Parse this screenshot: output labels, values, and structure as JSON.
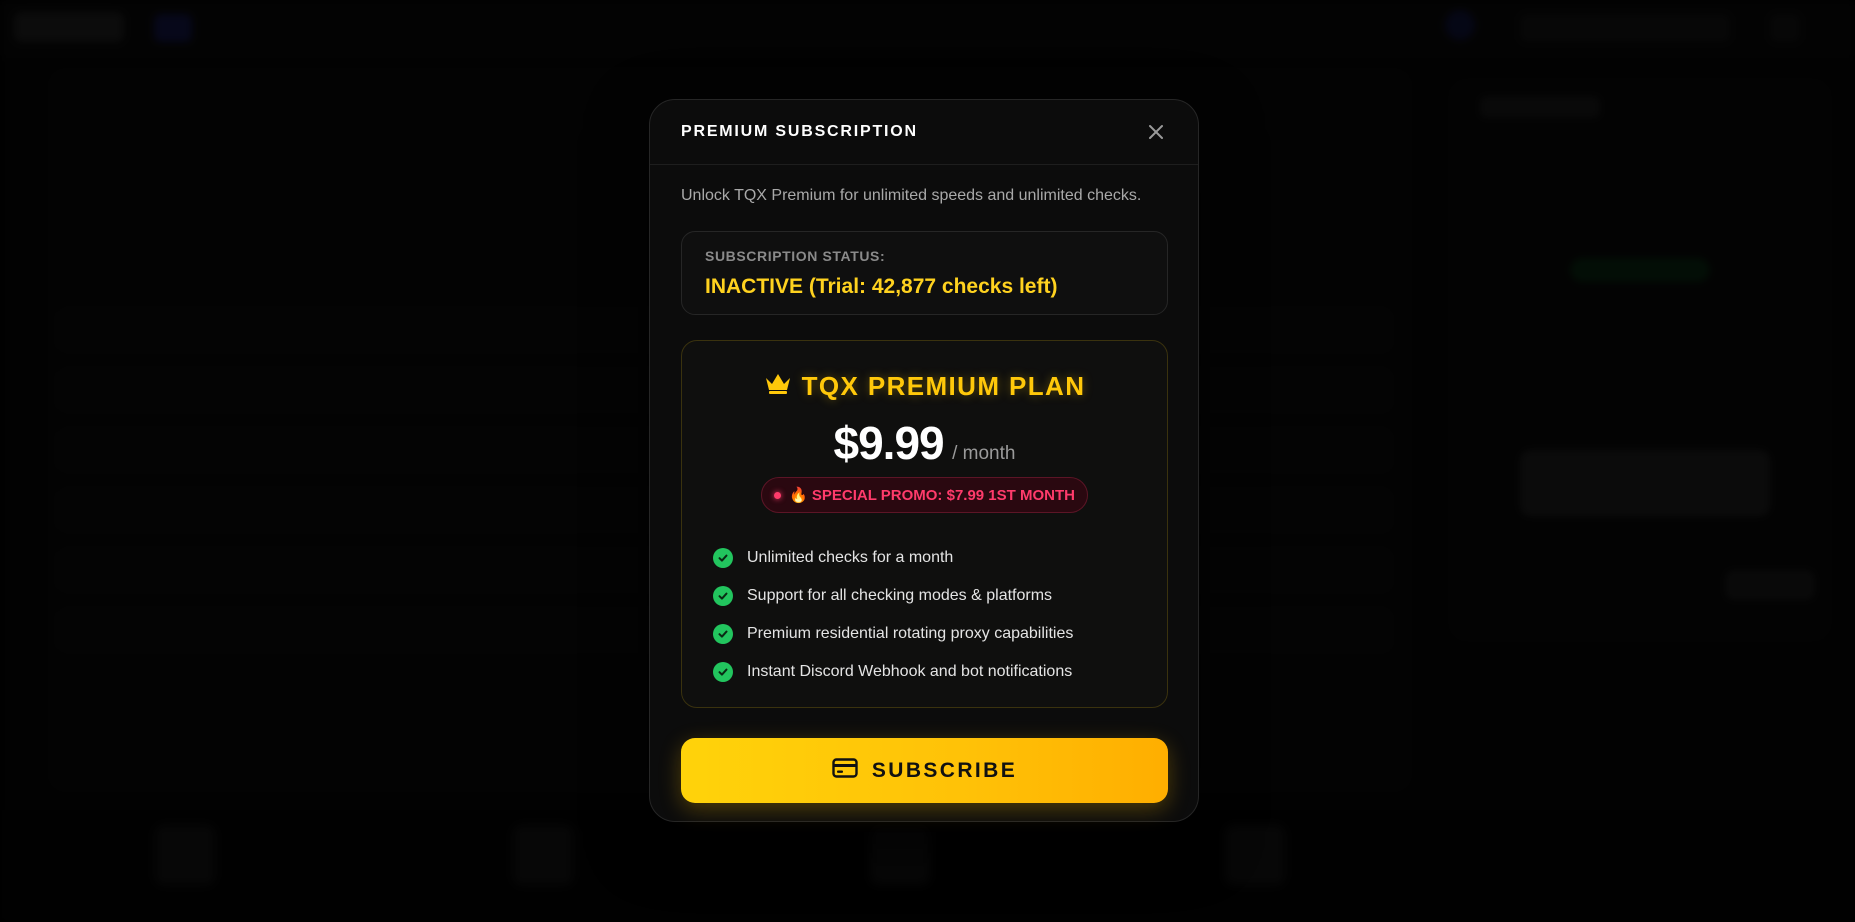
{
  "modal": {
    "title": "PREMIUM SUBSCRIPTION",
    "close_icon": "close-icon",
    "description": "Unlock TQX Premium for unlimited speeds and unlimited checks."
  },
  "status": {
    "label": "SUBSCRIPTION STATUS:",
    "value": "INACTIVE (Trial: 42,877 checks left)"
  },
  "plan": {
    "icon": "crown-icon",
    "title": "TQX PREMIUM PLAN",
    "price": "$9.99",
    "period": "/ month",
    "promo": "🔥 SPECIAL PROMO: $7.99 1ST MONTH",
    "features": [
      "Unlimited checks for a month",
      "Support for all checking modes & platforms",
      "Premium residential rotating proxy capabilities",
      "Instant Discord Webhook and bot notifications"
    ]
  },
  "subscribe": {
    "icon": "credit-card-icon",
    "label": "SUBSCRIBE"
  },
  "colors": {
    "accent": "#ffc80a",
    "status": "#ffd21f",
    "promo": "#ff3b6b",
    "check": "#22c55e",
    "background": "#0c0c0c"
  }
}
